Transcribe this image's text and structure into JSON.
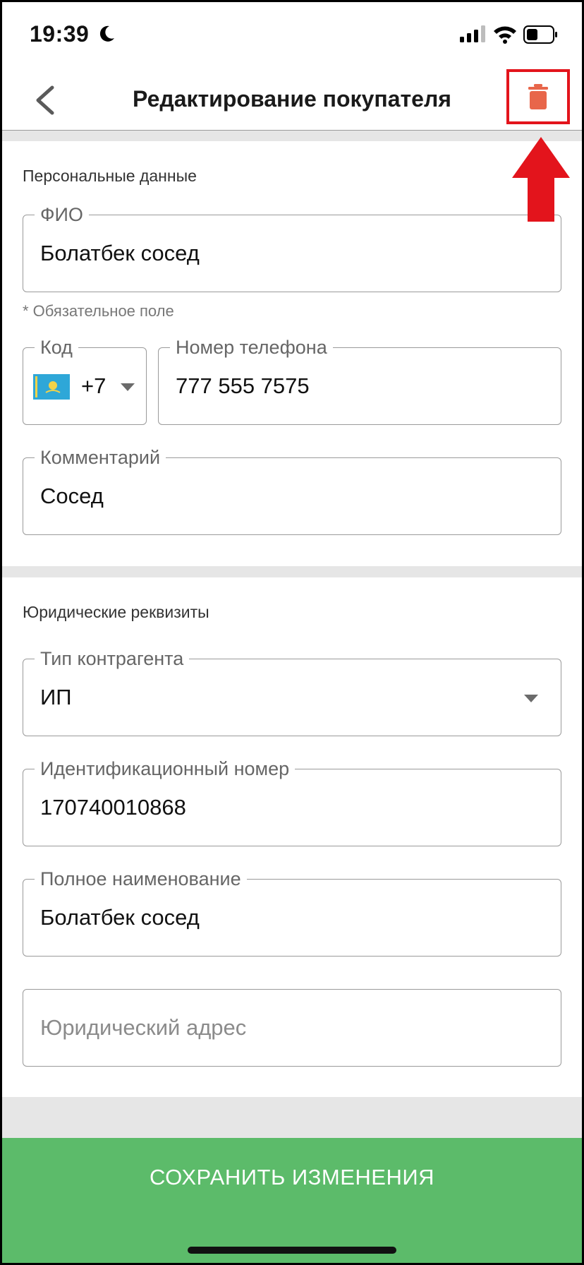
{
  "status_bar": {
    "time": "19:39"
  },
  "header": {
    "title": "Редактирование покупателя"
  },
  "personal": {
    "section_title": "Персональные данные",
    "fio": {
      "label": "ФИО",
      "value": "Болатбек сосед"
    },
    "required_hint": "* Обязательное поле",
    "code": {
      "label": "Код",
      "value": "+7"
    },
    "phone": {
      "label": "Номер телефона",
      "value": "777 555 7575"
    },
    "comment": {
      "label": "Комментарий",
      "value": "Сосед"
    }
  },
  "legal": {
    "section_title": "Юридические реквизиты",
    "counterparty_type": {
      "label": "Тип контрагента",
      "value": "ИП"
    },
    "id_number": {
      "label": "Идентификационный номер",
      "value": "170740010868"
    },
    "full_name": {
      "label": "Полное наименование",
      "value": "Болатбек сосед"
    },
    "legal_address": {
      "placeholder": "Юридический адрес"
    }
  },
  "footer": {
    "save_label": "СОХРАНИТЬ ИЗМЕНЕНИЯ"
  },
  "colors": {
    "accent_green": "#5cbb6a",
    "delete_icon": "#e8664a",
    "highlight_red": "#e3141c"
  },
  "icons": {
    "back": "chevron-left-icon",
    "delete": "trash-icon",
    "flag": "kazakhstan-flag-icon"
  }
}
